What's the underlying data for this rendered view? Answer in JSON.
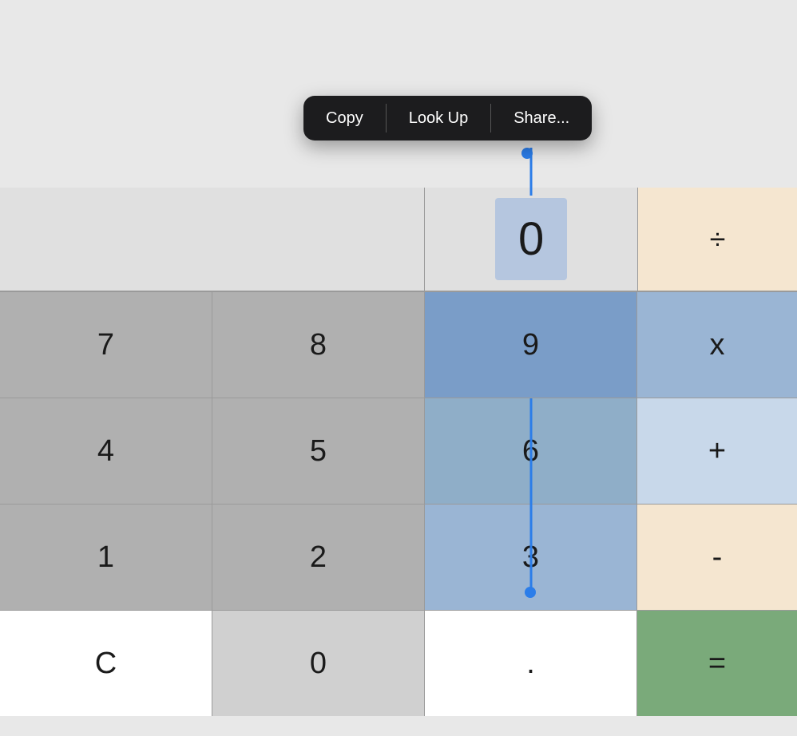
{
  "contextMenu": {
    "items": [
      {
        "id": "copy",
        "label": "Copy"
      },
      {
        "id": "lookup",
        "label": "Look Up"
      },
      {
        "id": "share",
        "label": "Share..."
      }
    ]
  },
  "display": {
    "value": "0"
  },
  "calculator": {
    "rows": [
      {
        "cells": [
          {
            "id": "7",
            "label": "7",
            "type": "number"
          },
          {
            "id": "8",
            "label": "8",
            "type": "number"
          },
          {
            "id": "9",
            "label": "9",
            "type": "number-selected"
          },
          {
            "id": "multiply",
            "label": "x",
            "type": "operator-light"
          }
        ]
      },
      {
        "cells": [
          {
            "id": "4",
            "label": "4",
            "type": "number"
          },
          {
            "id": "5",
            "label": "5",
            "type": "number"
          },
          {
            "id": "6",
            "label": "6",
            "type": "number-selected-light"
          },
          {
            "id": "add",
            "label": "+",
            "type": "operator-light"
          }
        ]
      },
      {
        "cells": [
          {
            "id": "1",
            "label": "1",
            "type": "number"
          },
          {
            "id": "2",
            "label": "2",
            "type": "number"
          },
          {
            "id": "3",
            "label": "3",
            "type": "number-selected-light"
          },
          {
            "id": "subtract",
            "label": "-",
            "type": "operator-orange"
          }
        ]
      },
      {
        "cells": [
          {
            "id": "clear",
            "label": "C",
            "type": "white"
          },
          {
            "id": "0",
            "label": "0",
            "type": "light-gray"
          },
          {
            "id": "decimal",
            "label": ".",
            "type": "white"
          },
          {
            "id": "equals",
            "label": "=",
            "type": "equals"
          }
        ]
      }
    ],
    "displayOperator": "÷"
  }
}
